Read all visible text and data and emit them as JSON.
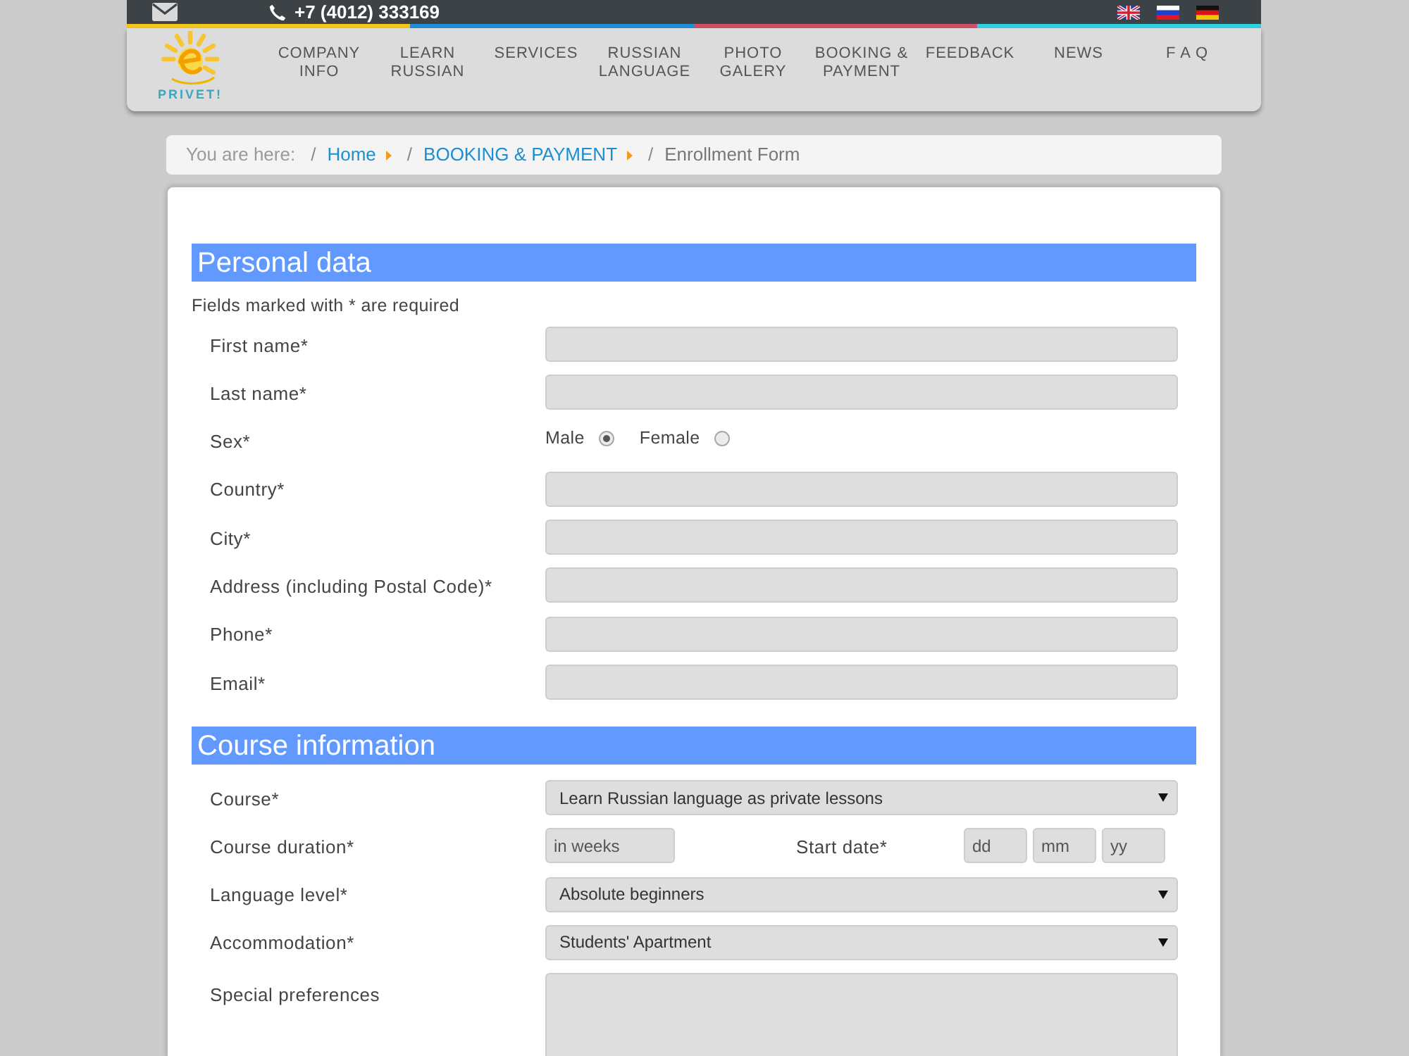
{
  "top_bar": {
    "phone": "+7 (4012) 333169"
  },
  "logo": {
    "text": "PRIVET!"
  },
  "nav": [
    "COMPANY INFO",
    "LEARN RUSSIAN",
    "SERVICES",
    "RUSSIAN LANGUAGE",
    "PHOTO GALERY",
    "BOOKING & PAYMENT",
    "FEEDBACK",
    "NEWS",
    "F A Q"
  ],
  "breadcrumb": {
    "prefix": "You are here:",
    "items": [
      {
        "separator": "/",
        "label": "Home",
        "kind": "link"
      },
      {
        "separator": "/",
        "label": "BOOKING & PAYMENT",
        "kind": "link"
      },
      {
        "separator": "/",
        "label": "Enrollment Form",
        "kind": "current"
      }
    ]
  },
  "form": {
    "sections": [
      {
        "title": "Personal data",
        "note": "Fields marked with * are required",
        "fields": [
          {
            "kind": "text",
            "label": "First name*"
          },
          {
            "kind": "text",
            "label": "Last name*"
          },
          {
            "kind": "radio",
            "label": "Sex*",
            "options": [
              {
                "label": "Male",
                "selected": true
              },
              {
                "label": "Female",
                "selected": false
              }
            ]
          },
          {
            "kind": "text",
            "label": "Country*"
          },
          {
            "kind": "text",
            "label": "City*"
          },
          {
            "kind": "text",
            "label": "Address (including Postal Code)*"
          },
          {
            "kind": "text",
            "label": "Phone*"
          },
          {
            "kind": "text",
            "label": "Email*"
          }
        ]
      },
      {
        "title": "Course information",
        "fields": [
          {
            "kind": "select",
            "label": "Course*",
            "value": "Learn Russian language as private lessons"
          },
          {
            "kind": "duration",
            "label": "Course duration*",
            "placeholder": "in weeks",
            "date_label": "Start date*",
            "date_parts": [
              {
                "placeholder": "dd"
              },
              {
                "placeholder": "mm"
              },
              {
                "placeholder": "yy"
              }
            ]
          },
          {
            "kind": "select",
            "label": "Language level*",
            "value": "Absolute beginners"
          },
          {
            "kind": "select",
            "label": "Accommodation*",
            "value": "Students' Apartment"
          },
          {
            "kind": "textarea",
            "label": "Special preferences"
          }
        ]
      }
    ]
  }
}
